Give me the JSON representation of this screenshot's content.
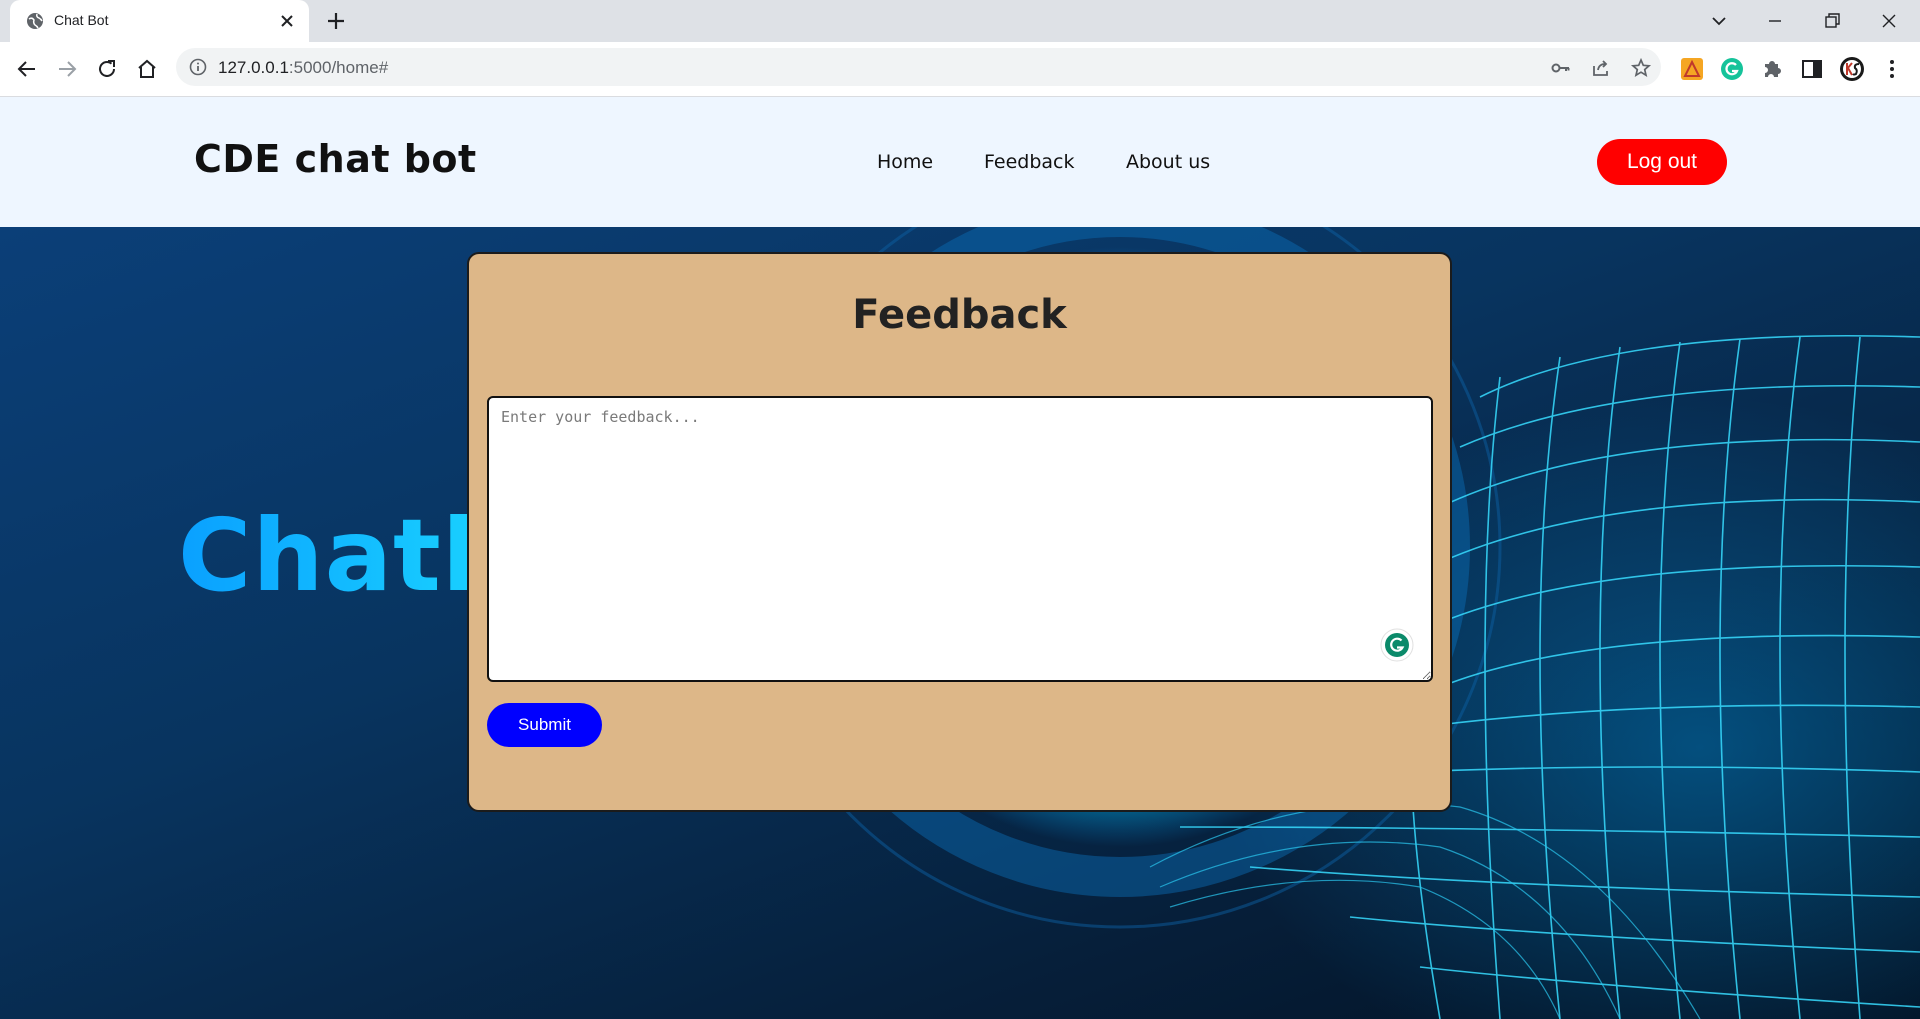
{
  "browser": {
    "tab_title": "Chat Bot",
    "url_host": "127.0.0.1",
    "url_rest": ":5000/home#"
  },
  "site": {
    "brand": "CDE chat bot",
    "nav": [
      {
        "label": "Home"
      },
      {
        "label": "Feedback"
      },
      {
        "label": "About us"
      }
    ],
    "logout_label": "Log out"
  },
  "hero": {
    "title": "Chatbot"
  },
  "feedback_modal": {
    "title": "Feedback",
    "input_placeholder": "Enter your feedback...",
    "input_value": "",
    "submit_label": "Submit"
  },
  "colors": {
    "logout_button": "#ff0000",
    "submit_button": "#0000ff",
    "modal_background": "#ddb788",
    "header_background": "#eef6ff",
    "hero_title": "#13c8ff"
  },
  "icons": {
    "tab_favicon": "globe-icon",
    "tab_close": "close-icon",
    "new_tab": "plus-icon",
    "back": "back-arrow-icon",
    "forward": "forward-arrow-icon",
    "reload": "reload-icon",
    "home": "home-icon",
    "site_info": "info-icon",
    "password": "key-icon",
    "share": "share-icon",
    "bookmark": "star-icon",
    "extensions": "puzzle-icon",
    "side_panel": "side-panel-icon",
    "profile": "profile-avatar",
    "menu": "kebab-menu-icon",
    "grammarly": "grammarly-icon"
  }
}
